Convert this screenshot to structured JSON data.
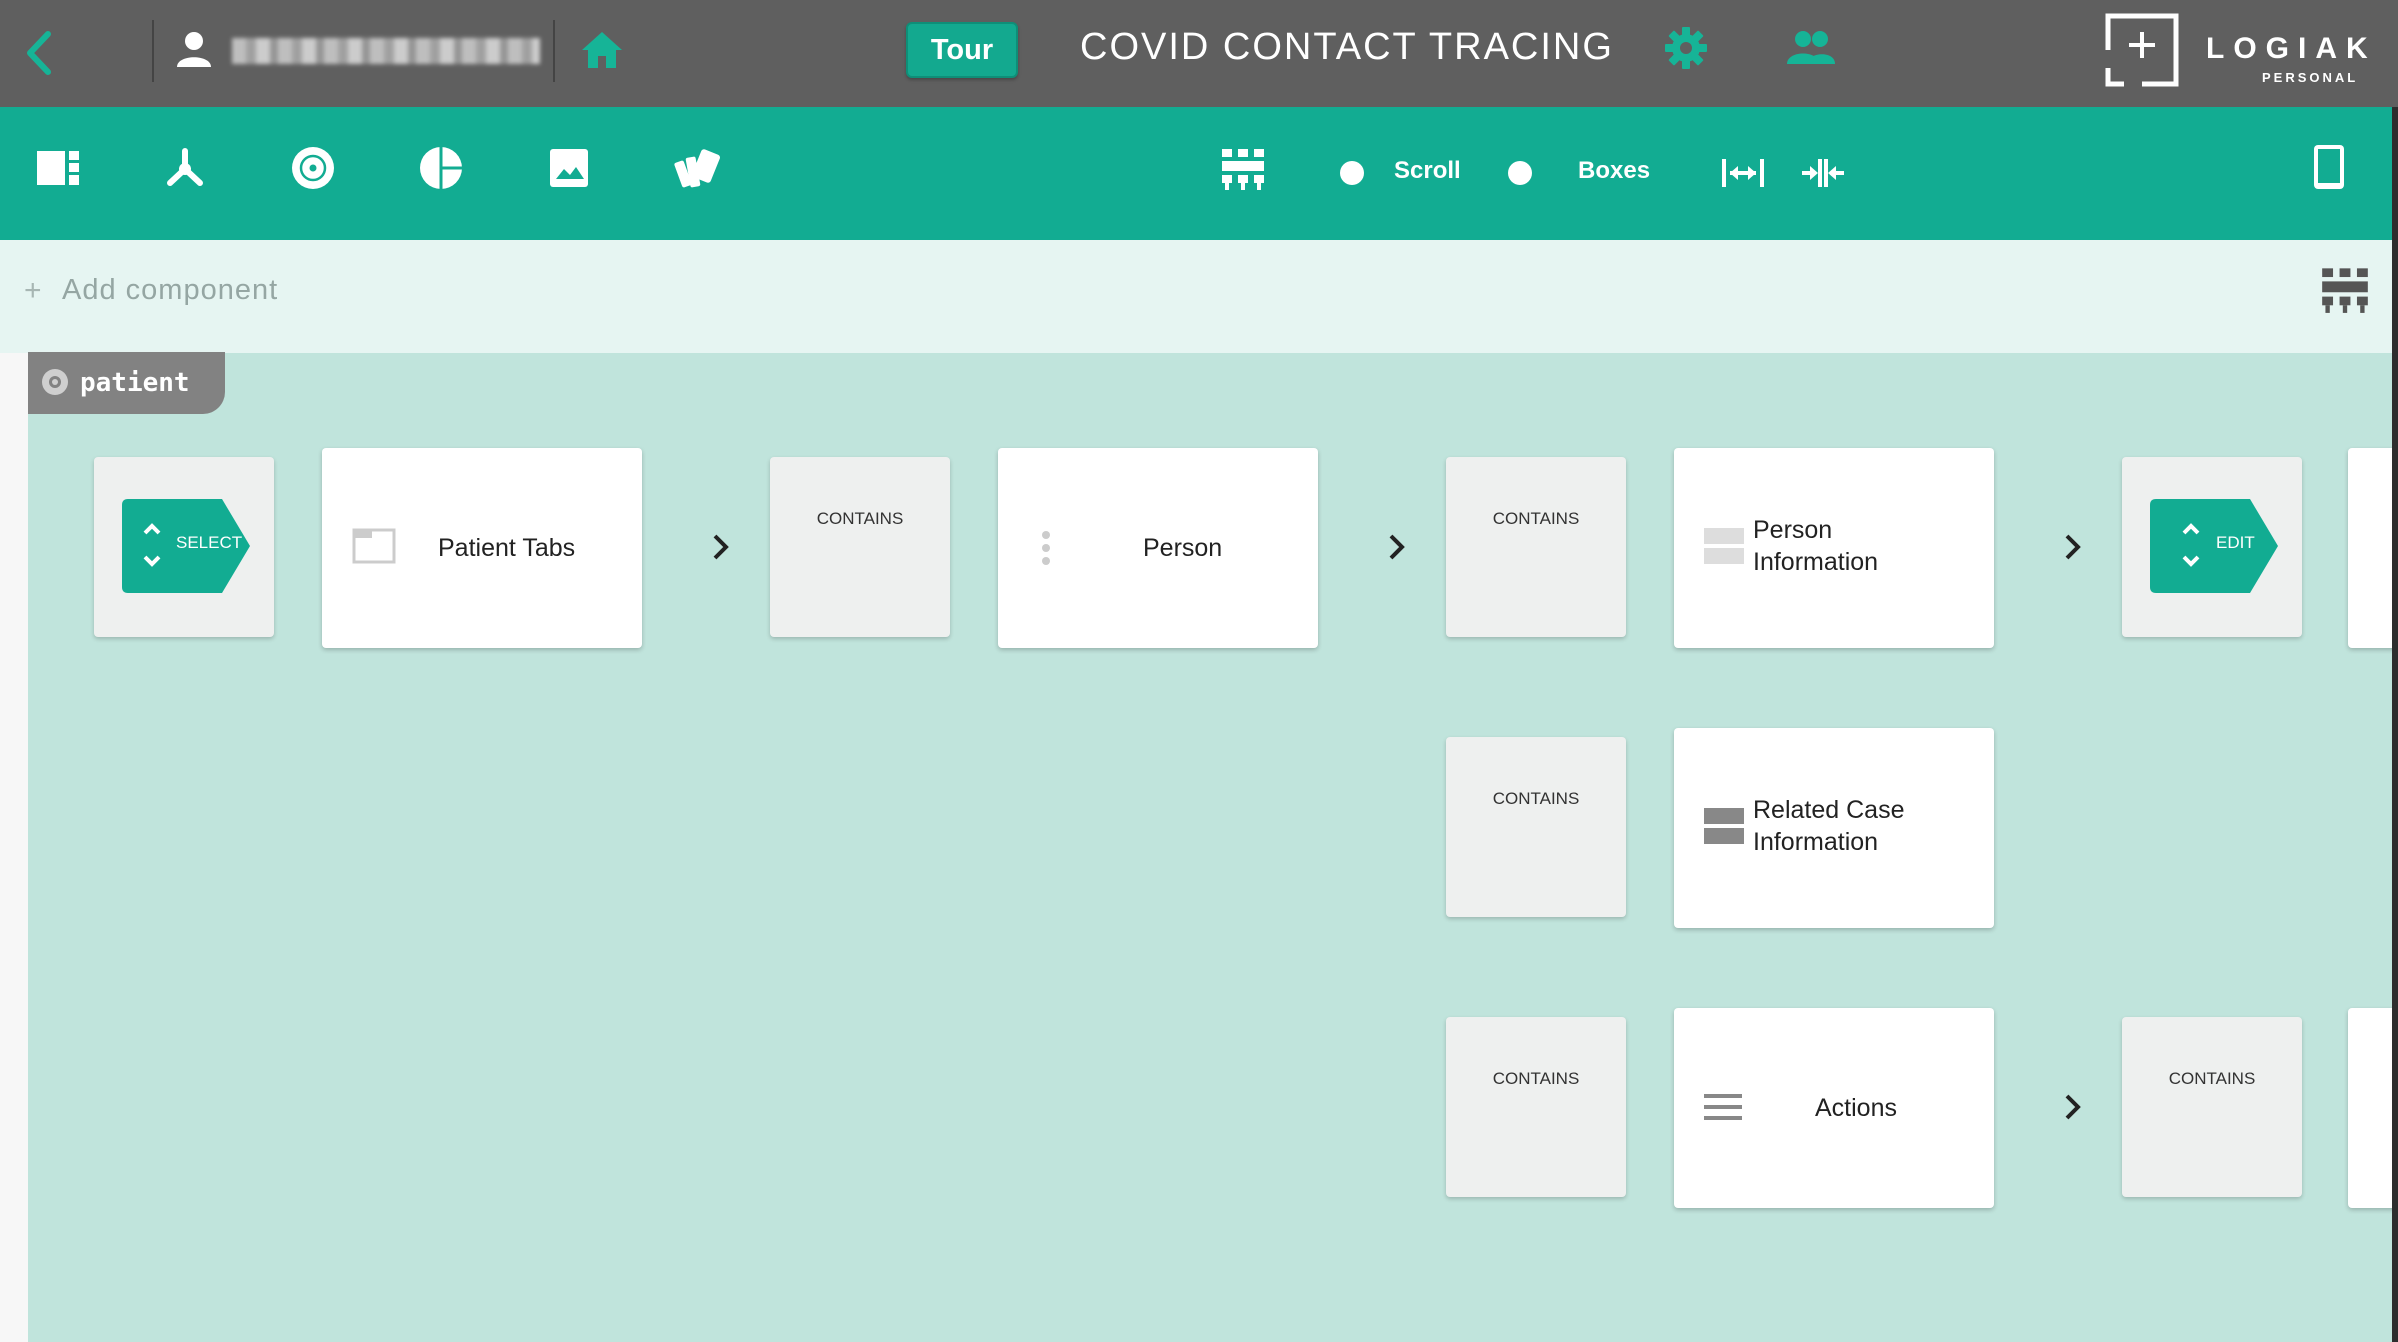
{
  "topbar": {
    "user_name": "",
    "tour_label": "Tour",
    "app_title": "COVID CONTACT TRACING",
    "logo_word": "LOGIAK",
    "logo_sub": "PERSONAL",
    "logo_mark": "+"
  },
  "toolbar": {
    "tools": [
      "layout-icon",
      "hierarchy-icon",
      "target-icon",
      "pie-chart-icon",
      "image-icon",
      "swatches-icon"
    ],
    "active_tool": "layout-icon",
    "columns_icon": "columns-icon",
    "scroll_label": "Scroll",
    "boxes_label": "Boxes",
    "expand_icon": "expand-width-icon",
    "collapse_icon": "collapse-width-icon",
    "device_icon": "tablet-icon"
  },
  "addbar": {
    "plus": "+",
    "label": "Add component"
  },
  "canvas": {
    "section_tag": "patient",
    "select_label": "SELECT",
    "edit_label": "EDIT",
    "contains_label": "CONTAINS",
    "cards": {
      "patient_tabs": "Patient Tabs",
      "person": "Person",
      "person_information": "Person Information",
      "related_case_information": "Related Case Information",
      "actions": "Actions"
    }
  },
  "colors": {
    "topbar": "#5f5f5f",
    "accent": "#12ac92",
    "canvas": "#c0e4dc",
    "addbar": "#e6f5f2"
  }
}
